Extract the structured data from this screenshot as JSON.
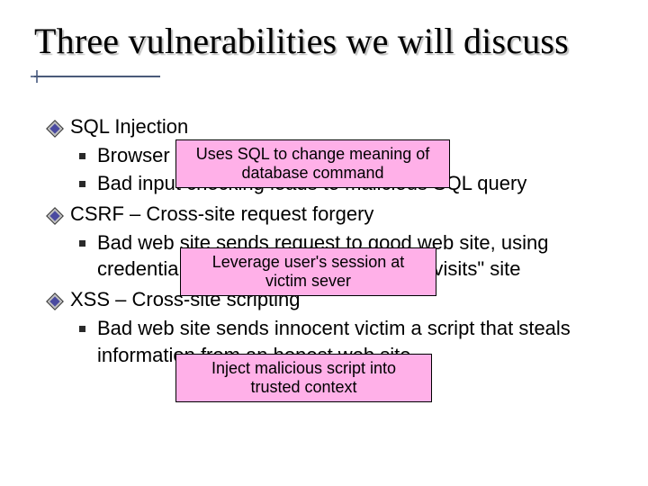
{
  "title": "Three vulnerabilities we will discuss",
  "items": [
    {
      "heading": "SQL Injection",
      "sub": [
        "Browser sends malicious input to server",
        "Bad input checking leads to malicious SQL query"
      ]
    },
    {
      "heading": "CSRF – Cross-site request forgery",
      "sub": [
        "Bad web site sends request to good web site, using credentials of an innocent victim who \"visits\" site"
      ]
    },
    {
      "heading": "XSS – Cross-site scripting",
      "sub": [
        "Bad web site sends innocent victim a script that steals information from an honest web site"
      ]
    }
  ],
  "overlays": {
    "sql": {
      "line1": "Uses SQL to change meaning of",
      "line2": "database command"
    },
    "csrf": {
      "line1": "Leverage user's session at",
      "line2": "victim sever"
    },
    "xss": {
      "line1": "Inject malicious script into",
      "line2": "trusted context"
    }
  }
}
